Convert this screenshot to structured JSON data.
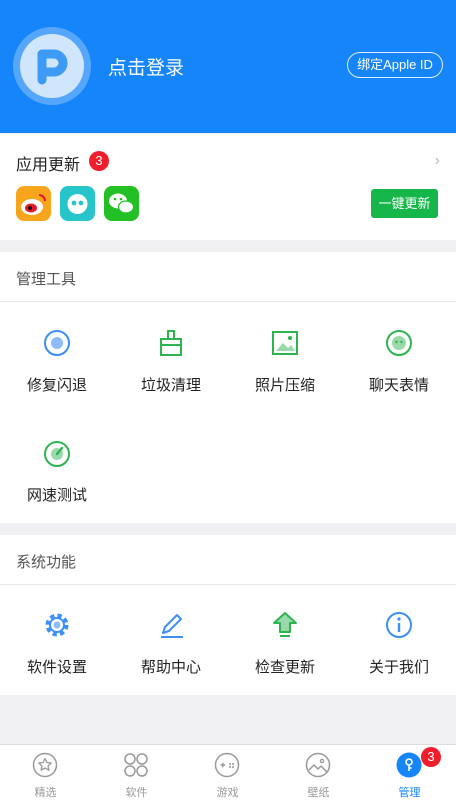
{
  "header": {
    "login_text": "点击登录",
    "bind_label": "绑定Apple ID",
    "brand_color": "#1685fa"
  },
  "updates": {
    "title": "应用更新",
    "badge_count": "3",
    "apps": [
      {
        "name": "weibo-app-icon"
      },
      {
        "name": "qq-app-icon"
      },
      {
        "name": "wechat-app-icon"
      }
    ],
    "update_all_label": "一键更新",
    "update_button_color": "#16b64a"
  },
  "management": {
    "title": "管理工具",
    "items": [
      {
        "label": "修复闪退",
        "icon": "repair-icon"
      },
      {
        "label": "垃圾清理",
        "icon": "clean-icon"
      },
      {
        "label": "照片压缩",
        "icon": "photo-icon"
      },
      {
        "label": "聊天表情",
        "icon": "emoji-icon"
      },
      {
        "label": "网速测试",
        "icon": "speed-icon"
      }
    ]
  },
  "system": {
    "title": "系统功能",
    "items": [
      {
        "label": "软件设置",
        "icon": "gear-icon"
      },
      {
        "label": "帮助中心",
        "icon": "pencil-icon"
      },
      {
        "label": "检查更新",
        "icon": "upgrade-icon"
      },
      {
        "label": "关于我们",
        "icon": "info-icon"
      }
    ]
  },
  "nav": {
    "items": [
      {
        "label": "精选",
        "icon": "star-icon"
      },
      {
        "label": "软件",
        "icon": "apps-icon"
      },
      {
        "label": "游戏",
        "icon": "gamepad-icon"
      },
      {
        "label": "壁纸",
        "icon": "wallpaper-icon"
      },
      {
        "label": "管理",
        "icon": "manage-icon",
        "active": true
      }
    ],
    "badge_count": "3"
  }
}
